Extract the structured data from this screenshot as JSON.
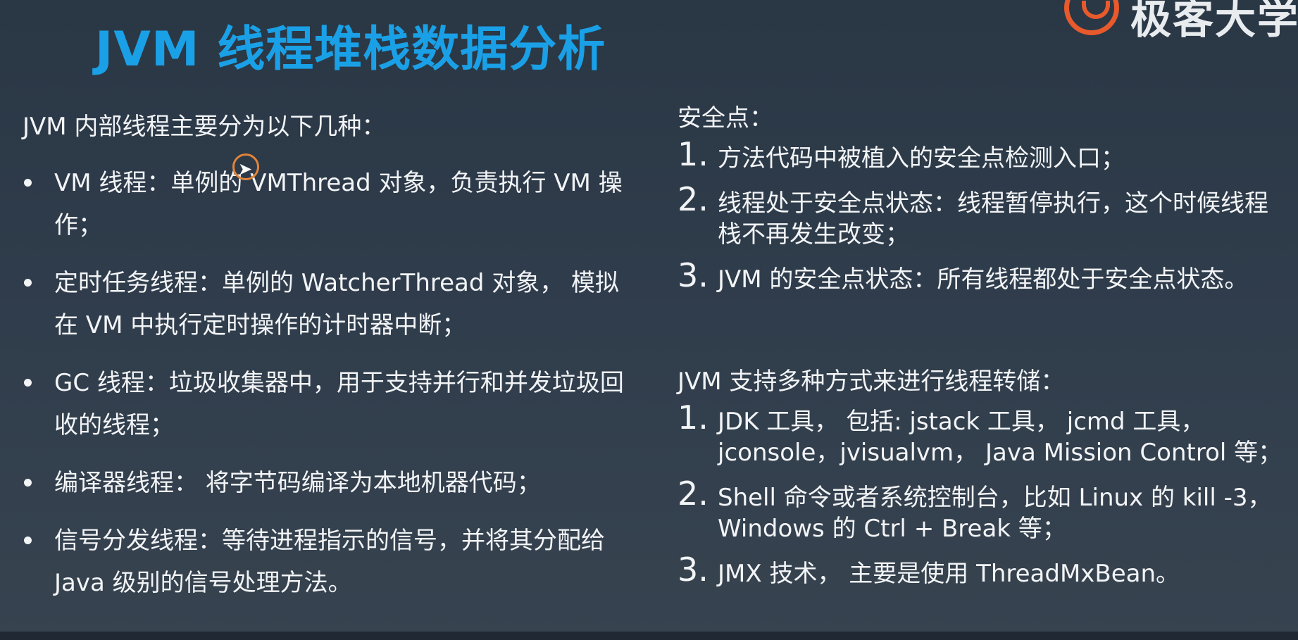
{
  "slide": {
    "title": "JVM 线程堆栈数据分析",
    "logo_text": "极客大学",
    "left": {
      "intro": "JVM 内部线程主要分为以下几种：",
      "bullets": [
        "VM 线程：单例的 VMThread 对象，负责执行 VM 操作；",
        "定时任务线程：单例的 WatcherThread 对象， 模拟在 VM 中执行定时操作的计时器中断；",
        "GC 线程：垃圾收集器中，用于支持并行和并发垃圾回收的线程；",
        "编译器线程： 将字节码编译为本地机器代码；",
        "信号分发线程：等待进程指示的信号，并将其分配给 Java 级别的信号处理方法。"
      ]
    },
    "right": {
      "safepoint_title": "安全点：",
      "safepoint_items": [
        {
          "n": "1.",
          "text": "方法代码中被植入的安全点检测入口；"
        },
        {
          "n": "2.",
          "text": "线程处于安全点状态：线程暂停执行，这个时候线程栈不再发生改变；"
        },
        {
          "n": "3.",
          "text": "JVM 的安全点状态：所有线程都处于安全点状态。"
        }
      ],
      "dump_title": "JVM 支持多种方式来进行线程转储：",
      "dump_items": [
        {
          "n": "1.",
          "text": "JDK 工具， 包括: jstack 工具， jcmd 工具， jconsole，jvisualvm， Java Mission Control 等；"
        },
        {
          "n": "2.",
          "text": "Shell 命令或者系统控制台，比如 Linux 的 kill -3， Windows 的 Ctrl + Break 等；"
        },
        {
          "n": "3.",
          "text": "JMX 技术， 主要是使用 ThreadMxBean。"
        }
      ]
    }
  },
  "colors": {
    "title": "#1aa0e6",
    "background_top": "#2a3745",
    "background_bottom": "#37434f",
    "logo_accent": "#e85a2c",
    "cursor_ring": "#e0853a"
  },
  "icons": {
    "logo": "geek-university-logo-icon",
    "cursor": "mouse-cursor-icon"
  }
}
